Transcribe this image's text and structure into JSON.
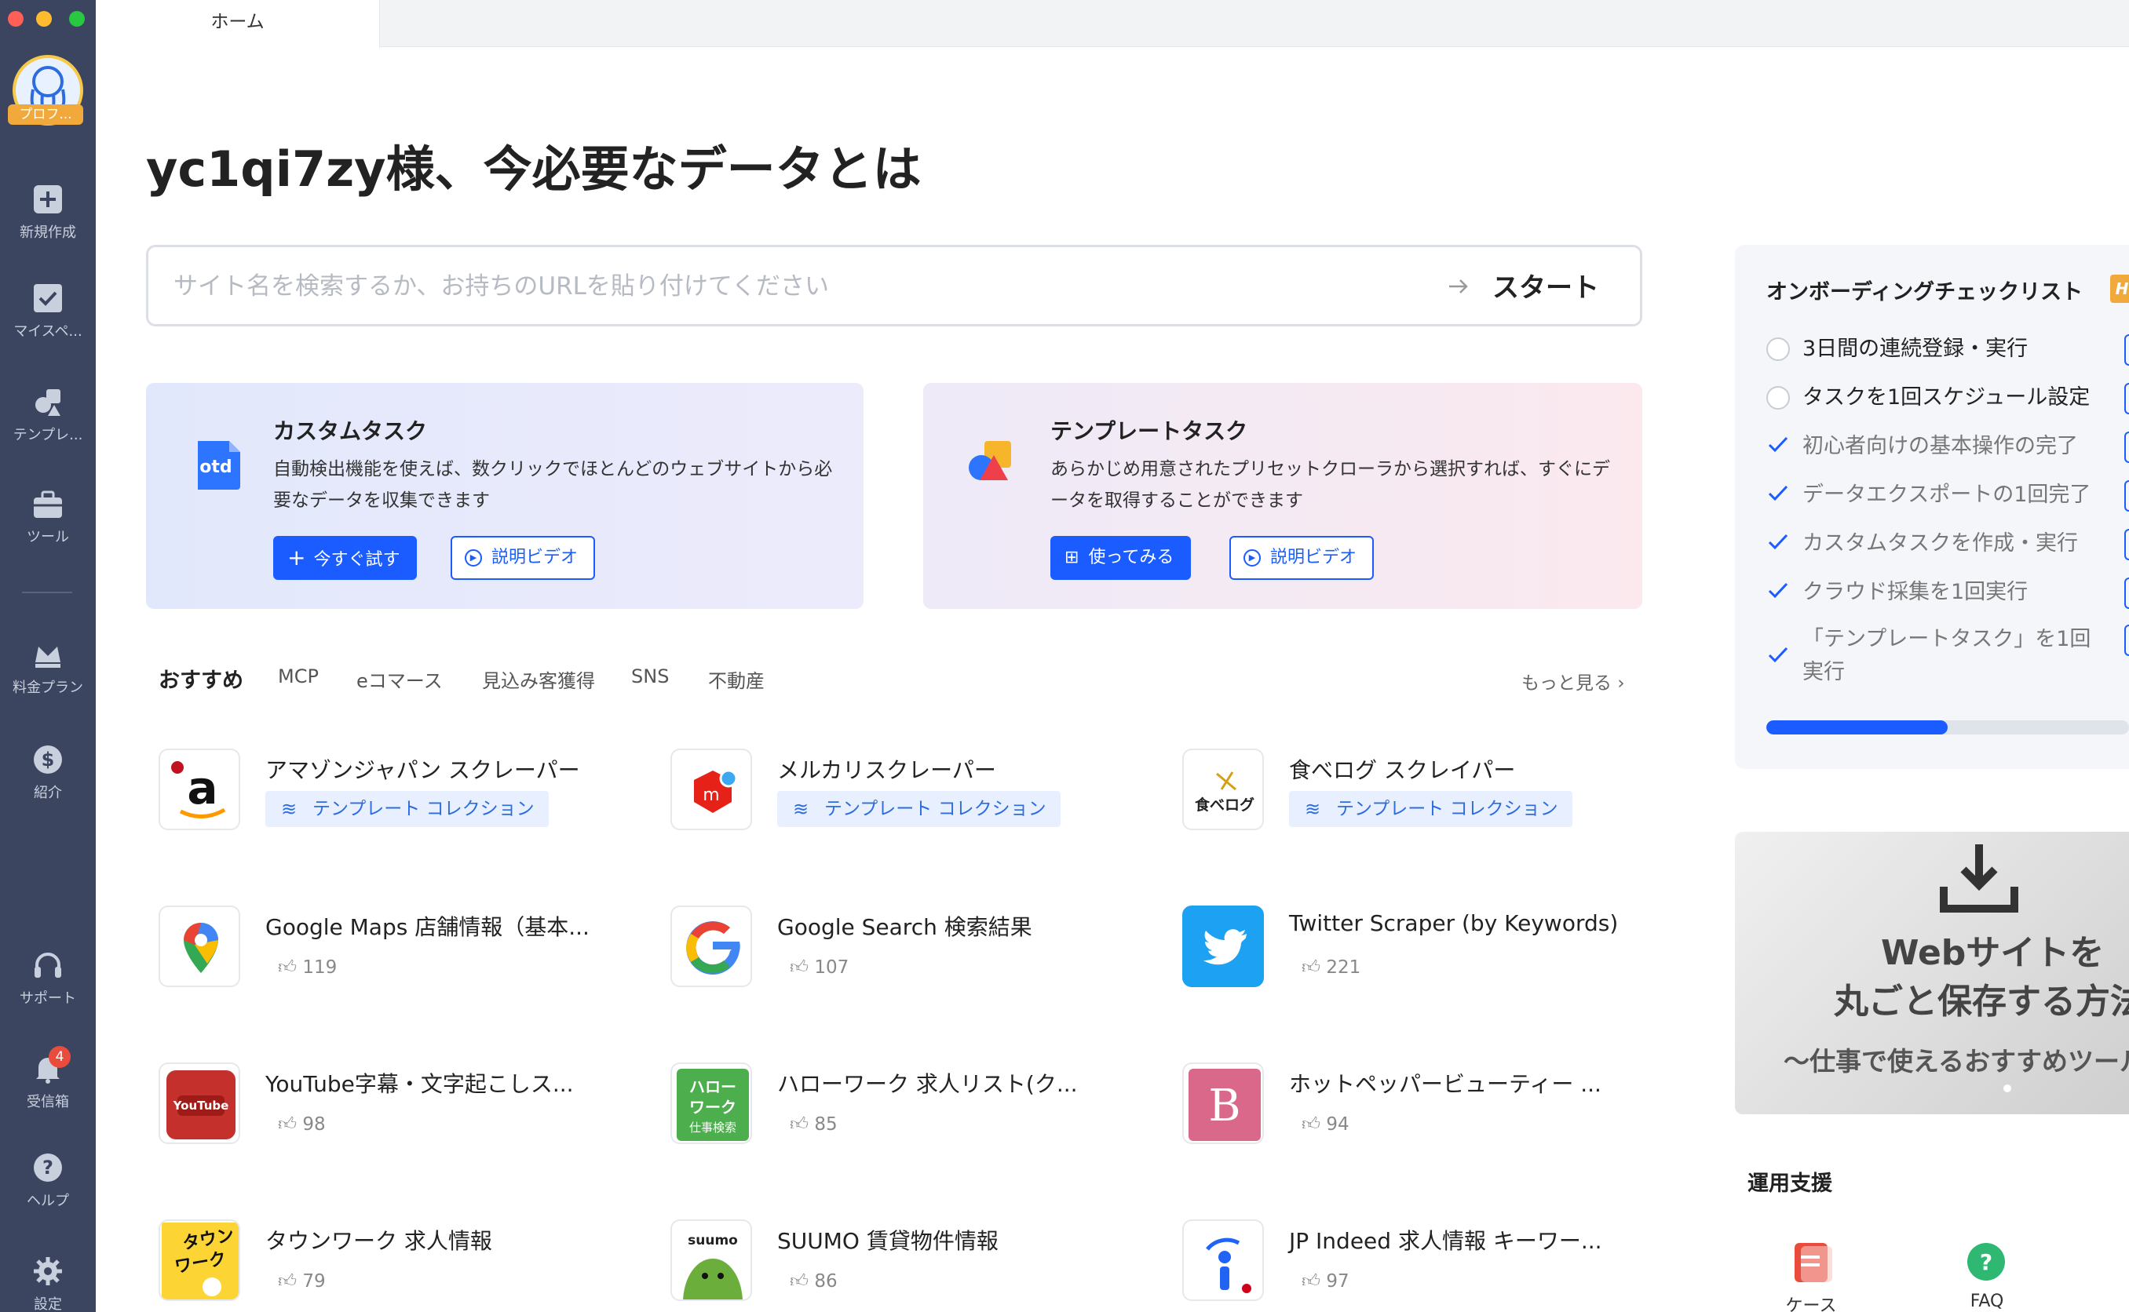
{
  "app": {
    "profile_badge": "プロフ...",
    "tab_home": "ホーム"
  },
  "sidebar": {
    "items": [
      {
        "label": "新規作成",
        "icon": "plus-square-icon"
      },
      {
        "label": "マイスペ...",
        "icon": "checkbox-icon"
      },
      {
        "label": "テンプレ...",
        "icon": "template-shapes-icon"
      },
      {
        "label": "ツール",
        "icon": "toolbox-icon"
      },
      {
        "label": "料金プラン",
        "icon": "crown-icon"
      },
      {
        "label": "紹介",
        "icon": "dollar-icon"
      },
      {
        "label": "サポート",
        "icon": "headset-icon"
      },
      {
        "label": "受信箱",
        "icon": "bell-icon"
      },
      {
        "label": "ヘルプ",
        "icon": "question-icon"
      },
      {
        "label": "設定",
        "icon": "gear-icon"
      }
    ],
    "inbox_count": "4"
  },
  "main": {
    "headline": "yc1qi7zy様、今必要なデータとは",
    "search": {
      "placeholder": "サイト名を検索するか、お持ちのURLを貼り付けてください",
      "start_label": "スタート"
    },
    "custom_card": {
      "title": "カスタムタスク",
      "description": "自動検出機能を使えば、数クリックでほとんどのウェブサイトから必要なデータを収集できます",
      "primary_label": "今すぐ試す",
      "video_label": "説明ビデオ",
      "logo_text": "otd"
    },
    "template_card": {
      "title": "テンプレートタスク",
      "description": "あらかじめ用意されたプリセットクローラから選択すれば、すぐにデータを取得することができます",
      "primary_label": "使ってみる",
      "video_label": "説明ビデオ"
    },
    "categories": [
      "おすすめ",
      "MCP",
      "eコマース",
      "見込み客獲得",
      "SNS",
      "不動産"
    ],
    "see_more": "もっと見る",
    "templates": [
      {
        "title": "アマゾンジャパン スクレーパー",
        "tag": "テンプレート コレクション",
        "logo": "amazon-logo-icon"
      },
      {
        "title": "メルカリスクレーパー",
        "tag": "テンプレート コレクション",
        "logo": "mercari-logo-icon"
      },
      {
        "title": "食べログ スクレイパー",
        "tag": "テンプレート コレクション",
        "logo": "tabelog-logo-icon",
        "logo_text": "食べログ"
      },
      {
        "title": "Google Maps 店舗情報（基本...",
        "likes": "119",
        "logo": "google-maps-logo-icon"
      },
      {
        "title": "Google Search 検索結果",
        "likes": "107",
        "logo": "google-logo-icon"
      },
      {
        "title": "Twitter Scraper (by Keywords)",
        "likes": "221",
        "logo": "twitter-logo-icon"
      },
      {
        "title": "YouTube字幕・文字起こしス...",
        "likes": "98",
        "logo": "youtube-logo-icon",
        "logo_text": "YouTube"
      },
      {
        "title": "ハローワーク 求人リスト(ク...",
        "likes": "85",
        "logo": "hellowork-logo-icon",
        "logo_text": "ハロー ワーク 仕事検索"
      },
      {
        "title": "ホットペッパービューティー ...",
        "likes": "94",
        "logo": "hotpepper-logo-icon",
        "logo_text": "B"
      },
      {
        "title": "タウンワーク 求人情報",
        "likes": "79",
        "logo": "townwork-logo-icon",
        "logo_text": "タウン ワーク"
      },
      {
        "title": "SUUMO 賃貸物件情報",
        "likes": "86",
        "logo": "suumo-logo-icon",
        "logo_text": "suumo"
      },
      {
        "title": "JP Indeed 求人情報 キーワー...",
        "likes": "97",
        "logo": "indeed-logo-icon"
      }
    ]
  },
  "onboarding": {
    "title": "オンボーディングチェックリスト",
    "hot_badge": "H",
    "items": [
      {
        "label": "3日間の連続登録・実行",
        "done": false
      },
      {
        "label": "タスクを1回スケジュール設定",
        "done": false
      },
      {
        "label": "初心者向けの基本操作の完了",
        "done": true
      },
      {
        "label": "データエクスポートの1回完了",
        "done": true
      },
      {
        "label": "カスタムタスクを作成・実行",
        "done": true
      },
      {
        "label": "クラウド採集を1回実行",
        "done": true
      },
      {
        "label": "「テンプレートタスク」を1回",
        "label2": "実行",
        "done": true
      }
    ],
    "progress": 0.5
  },
  "banner": {
    "line1": "Webサイトを",
    "line2": "丸ごと保存する方法",
    "line3": "〜仕事で使えるおすすめツール"
  },
  "support": {
    "title": "運用支援",
    "items": [
      {
        "label": "ケース",
        "icon": "document-icon",
        "color": "#e94c3d"
      },
      {
        "label": "FAQ",
        "icon": "faq-icon",
        "color": "#2eb872"
      }
    ]
  },
  "colors": {
    "sidebar_bg": "#3b4560",
    "accent": "#1a5cff",
    "tag_bg": "#e8f0ff"
  }
}
